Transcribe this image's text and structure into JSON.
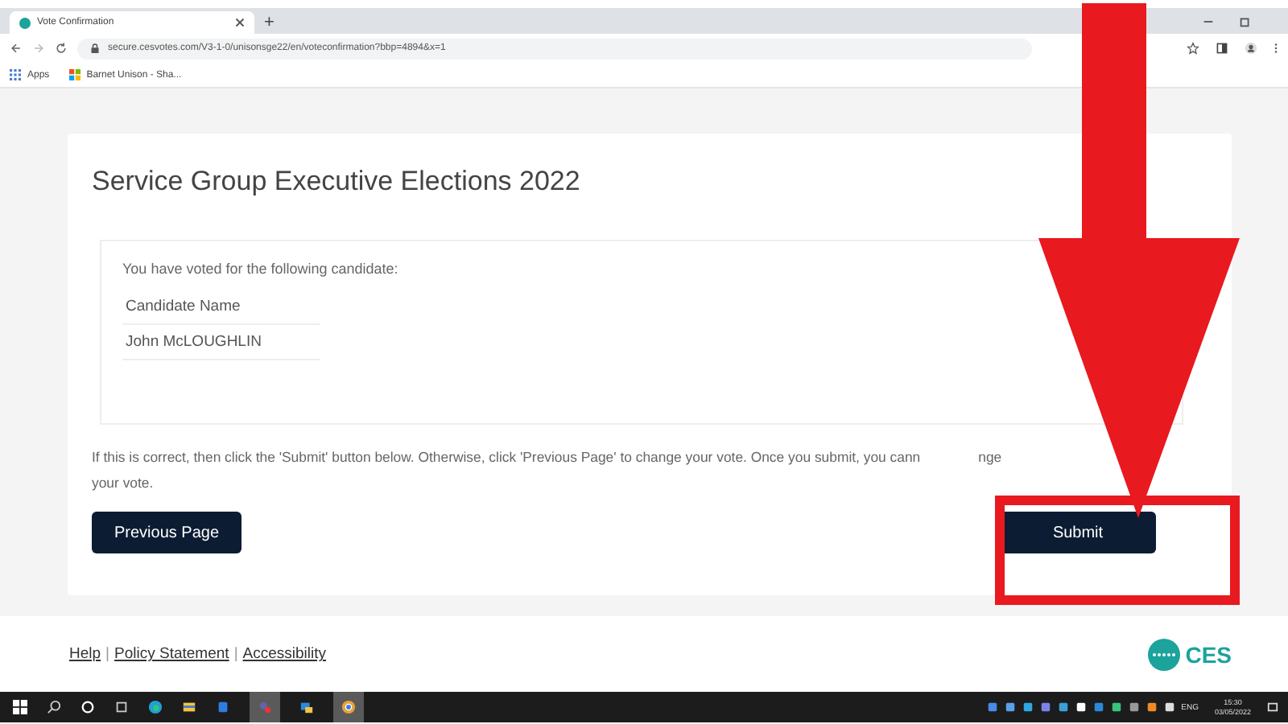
{
  "browser": {
    "tab_title": "Vote Confirmation",
    "new_tab": "+",
    "url": "secure.cesvotes.com/V3-1-0/unisonsge22/en/voteconfirmation?bbp=4894&x=1",
    "bookmarks": [
      "Apps",
      "Barnet Unison - Sha..."
    ]
  },
  "page": {
    "title": "Service Group Executive Elections 2022",
    "intro": "You have voted for the following candidate:",
    "column_header": "Candidate Name",
    "candidate": "John McLOUGHLIN",
    "instruction_parts": [
      "If this is correct, then click the 'Submit' button below. Otherwise, click 'Previous Page' to change your vote. Once you submit, you cann",
      "nge",
      "your vote."
    ],
    "buttons": [
      "Previous Page",
      "Submit"
    ]
  },
  "footer": {
    "links": [
      "Help",
      "Policy Statement",
      "Accessibility"
    ],
    "separator": "|",
    "logo": "CES"
  },
  "taskbar": {
    "language": "ENG",
    "time": "15:30",
    "date": "03/05/2022"
  }
}
